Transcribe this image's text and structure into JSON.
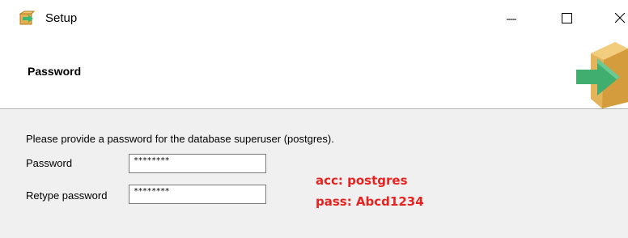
{
  "window": {
    "title": "Setup",
    "icon": "setup-app-icon"
  },
  "header": {
    "title": "Password",
    "logo_icon": "install-box-arrow-icon"
  },
  "form": {
    "instruction": "Please provide a password for the database superuser (postgres).",
    "password_label": "Password",
    "password_value": "********",
    "retype_label": "Retype password",
    "retype_value": "********"
  },
  "annotation": {
    "account": "acc: postgres",
    "password": "pass: Abcd1234",
    "color": "#e8231f"
  }
}
